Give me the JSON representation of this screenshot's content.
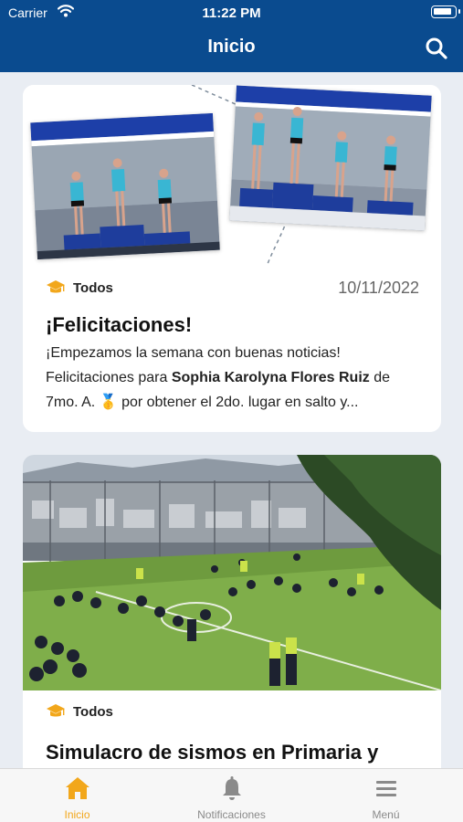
{
  "status_bar": {
    "carrier": "Carrier",
    "time": "11:22 PM",
    "battery_level": 0.9
  },
  "header": {
    "title": "Inicio"
  },
  "posts": [
    {
      "category": "Todos",
      "date": "10/11/2022",
      "title": "¡Felicitaciones!",
      "body_before": "¡Empezamos la semana con buenas noticias! Felicitaciones para ",
      "body_bold": "Sophia Karolyna Flores Ruiz",
      "body_after": " de 7mo. A. 🥇 por obtener el 2do. lugar en salto y..."
    },
    {
      "category": "Todos",
      "title": "Simulacro de sismos en Primaria y"
    }
  ],
  "tabbar": {
    "tabs": [
      {
        "label": "Inicio",
        "icon": "home-icon",
        "active": true
      },
      {
        "label": "Notificaciones",
        "icon": "bell-icon",
        "active": false
      },
      {
        "label": "Menú",
        "icon": "menu-icon",
        "active": false
      }
    ]
  },
  "colors": {
    "primary": "#0a4b8f",
    "accent": "#f2a71b",
    "background": "#e9edf3"
  }
}
